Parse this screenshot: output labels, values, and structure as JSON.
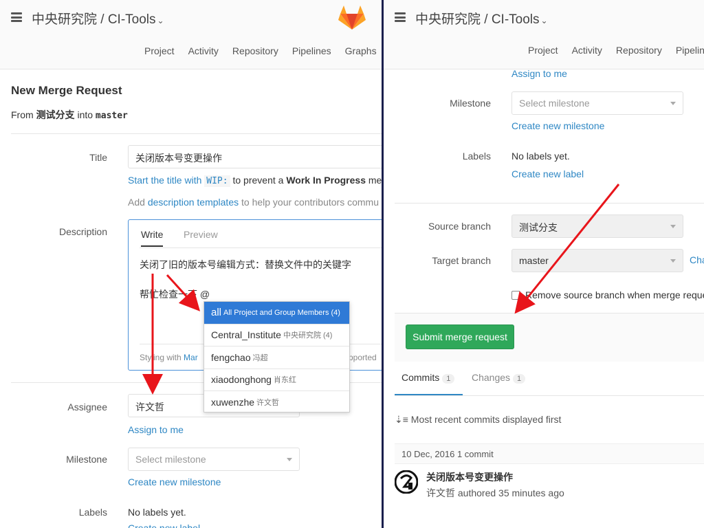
{
  "header": {
    "brand": "中央研究院 / CI-Tools",
    "nav": [
      "Project",
      "Activity",
      "Repository",
      "Pipelines",
      "Graphs"
    ],
    "nav_right": [
      "Project",
      "Activity",
      "Repository",
      "Pipelin"
    ]
  },
  "form": {
    "page_title": "New Merge Request",
    "from_label": "From",
    "source_branch": "测试分支",
    "into_label": "into",
    "target_branch": "master",
    "title_label": "Title",
    "title_value": "关闭版本号变更操作",
    "wip_hint_pre": "Start the title with",
    "wip_code": "WIP:",
    "wip_hint_mid": "to prevent a",
    "wip_hint_bold": "Work In Progress",
    "wip_hint_post": "me",
    "templates_pre": "Add",
    "templates_link": "description templates",
    "templates_post": "to help your contributors commu",
    "description_label": "Description",
    "tab_write": "Write",
    "tab_preview": "Preview",
    "desc_line1": "关闭了旧的版本号编辑方式：替换文件中的关键字",
    "desc_line2": "帮忙检查一下 @",
    "styling_pre": "Styling with",
    "styling_link": "Mar",
    "styling_post": "pported",
    "assignee_label": "Assignee",
    "assignee_value": "许文哲",
    "assign_to_me": "Assign to me",
    "milestone_label": "Milestone",
    "milestone_placeholder": "Select milestone",
    "create_milestone": "Create new milestone",
    "labels_label": "Labels",
    "no_labels": "No labels yet.",
    "create_label": "Create new label",
    "source_branch_label": "Source branch",
    "target_branch_label": "Target branch",
    "change_branches": "Cha",
    "remove_source": "Remove source branch when merge reques",
    "submit": "Submit merge request"
  },
  "mentions": [
    {
      "name": "all",
      "detail": "All Project and Group Members (4)"
    },
    {
      "name": "Central_Institute",
      "detail": "中央研究院 (4)"
    },
    {
      "name": "fengchao",
      "detail": "冯超"
    },
    {
      "name": "xiaodonghong",
      "detail": "肖东红"
    },
    {
      "name": "xuwenzhe",
      "detail": "许文哲"
    }
  ],
  "tabs": {
    "commits": "Commits",
    "commits_count": "1",
    "changes": "Changes",
    "changes_count": "1"
  },
  "commits": {
    "order_note": "Most recent commits displayed first",
    "date_header": "10 Dec, 2016 1 commit",
    "items": [
      {
        "title": "关闭版本号变更操作",
        "author": "许文哲",
        "meta": "authored 35 minutes ago"
      }
    ]
  },
  "colors": {
    "link": "#2e87c4",
    "success": "#2fa85a",
    "active_mention": "#2f7ad6",
    "arrow": "#e8151b",
    "divider": "#1a1f4d"
  }
}
